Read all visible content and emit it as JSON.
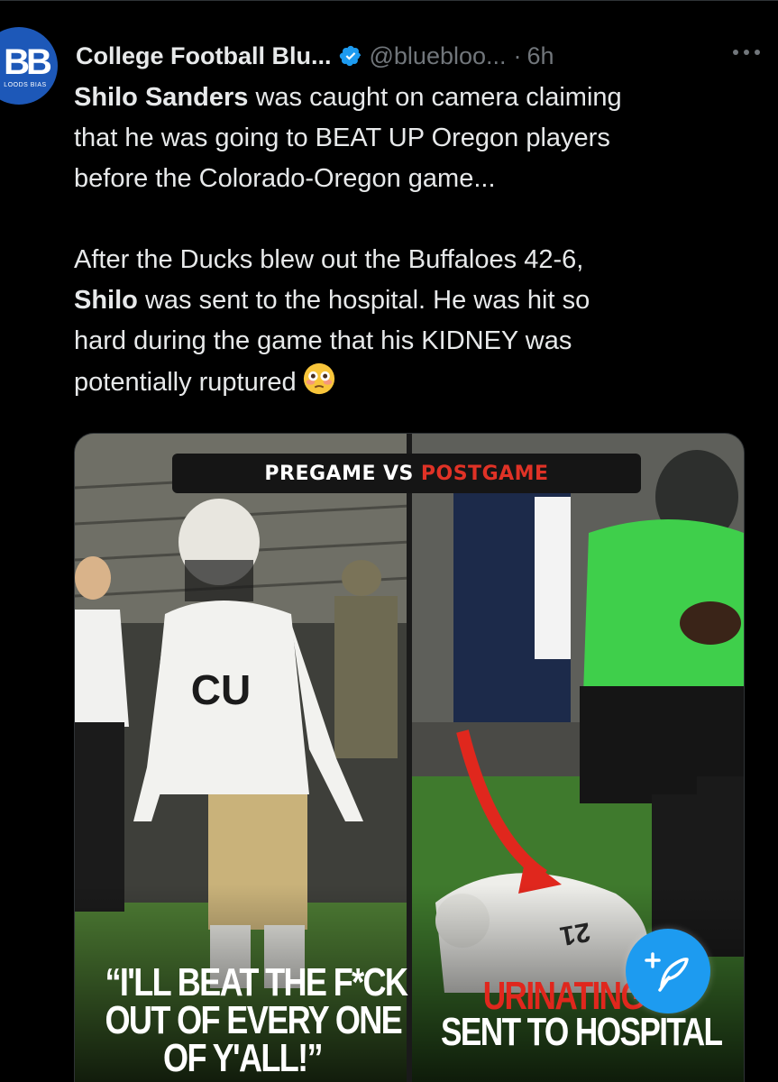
{
  "avatar": {
    "monogram": "BB",
    "subtitle": "LOODS BIAS"
  },
  "header": {
    "display_name": "College Football Blu...",
    "handle": "@bluebloo...",
    "separator": "·",
    "time": "6h",
    "verified_icon": "verified-badge-icon",
    "more_icon": "more-options-icon"
  },
  "tweet": {
    "p1": {
      "line1_bold": "Shilo Sanders",
      "line1_rest": " was caught on camera claiming",
      "line2": "that he was going to BEAT UP Oregon players",
      "line3": "before the Colorado-Oregon game..."
    },
    "p2": {
      "line1": "After the Ducks blew out the Buffaloes 42-6,",
      "line2_bold": "Shilo",
      "line2_rest": " was sent to the hospital. He was hit so",
      "line3": "hard during the game that his KIDNEY was",
      "line4": "potentially ruptured",
      "emoji": "flushed-face-emoji"
    }
  },
  "media": {
    "banner": {
      "pre": "PREGAME",
      "vs": "VS",
      "post": "POSTGAME"
    },
    "caption_left": [
      "“I'LL BEAT THE F*CK",
      "OUT OF EVERY ONE",
      "OF Y'ALL!”"
    ],
    "caption_right": {
      "red": "URINATING B",
      "white": "SENT TO HOSPITAL"
    },
    "colors": {
      "oregon_green": "#3fcf4b",
      "colorado_gold": "#c8b27c",
      "red_arrow": "#e0271d",
      "banner_red": "#e03226"
    }
  },
  "fab": {
    "icon": "compose-post-icon",
    "color": "#1d9bf0"
  }
}
